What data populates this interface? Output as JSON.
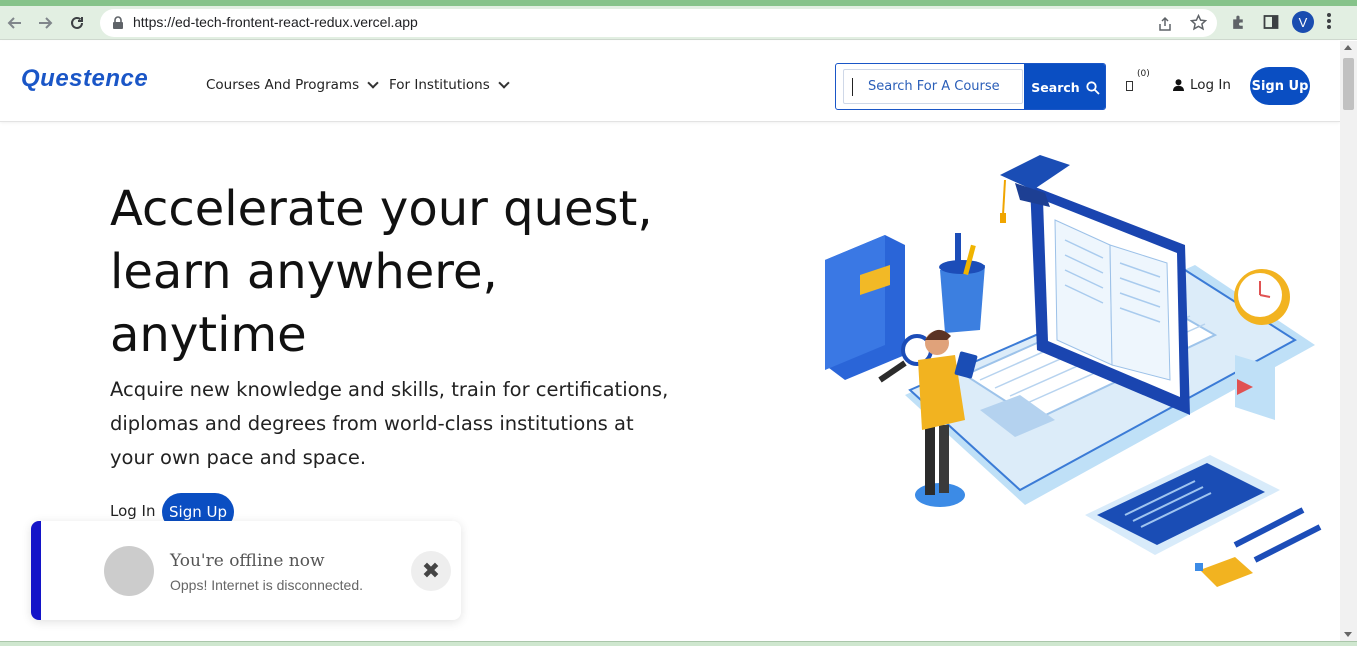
{
  "browser": {
    "url": "https://ed-tech-frontent-react-redux.vercel.app",
    "profile_initial": "V",
    "icons": [
      "back-icon",
      "forward-icon",
      "reload-icon",
      "lock-icon",
      "share-icon",
      "star-icon",
      "extensions-icon",
      "sidebar-icon",
      "menu-icon"
    ]
  },
  "header": {
    "logo": "Questence",
    "nav": [
      {
        "label": "Courses And Programs"
      },
      {
        "label": "For Institutions"
      }
    ],
    "search": {
      "placeholder": "Search For A Course",
      "button_label": "Search"
    },
    "cart_count": "(0)",
    "login_label": "Log In",
    "signup_label": "Sign Up"
  },
  "hero": {
    "title_lines": [
      "Accelerate your quest,",
      "learn anywhere,",
      "anytime"
    ],
    "subtitle": "Acquire new knowledge and skills, train for certifications, diplomas and degrees from world-class institutions at your own pace and space.",
    "login_label": "Log In",
    "signup_label": "Sign Up"
  },
  "toast": {
    "title": "You're offline now",
    "message": "Opps! Internet is disconnected.",
    "close_symbol": "✖"
  },
  "colors": {
    "brand": "#0a4ec2",
    "toast_accent": "#1414c8",
    "browser_frame": "#e2efe2"
  }
}
